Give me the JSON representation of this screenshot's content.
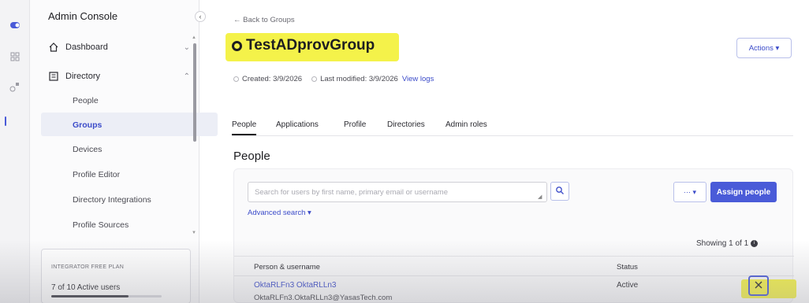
{
  "sidebar": {
    "app_title": "Admin Console",
    "collapse_glyph": "‹",
    "nav": [
      {
        "label": "Dashboard",
        "icon": "home-icon",
        "chevron": "⌄"
      },
      {
        "label": "Directory",
        "icon": "directory-icon",
        "chevron": "⌃"
      }
    ],
    "directory_items": [
      "People",
      "Groups",
      "Devices",
      "Profile Editor",
      "Directory Integrations",
      "Profile Sources"
    ],
    "selected_item": "Groups",
    "plan": {
      "label": "INTEGRATOR FREE PLAN",
      "users_text": "7 of 10 Active users",
      "usage_fraction": 0.7
    }
  },
  "main": {
    "back_link": "← Back to Groups",
    "group_name": "TestADprovGroup",
    "actions_label": "Actions ▾",
    "created": "Created: 3/9/2026",
    "modified": "Last modified: 3/9/2026",
    "view_logs": "View logs",
    "tabs": [
      "People",
      "Applications",
      "Profile",
      "Directories",
      "Admin roles"
    ],
    "active_tab": "People",
    "section_title": "People",
    "search_placeholder": "Search for users by first name, primary email or username",
    "advanced_search": "Advanced search ▾",
    "more_label": "··· ▾",
    "assign_label": "Assign people",
    "showing": "Showing 1 of 1",
    "columns": [
      "Person & username",
      "Status"
    ],
    "rows": [
      {
        "name": "OktaRLFn3 OktaRLLn3",
        "email": "OktaRLFn3.OktaRLLn3@YasasTech.com",
        "status": "Active"
      }
    ]
  },
  "colors": {
    "accent": "#4a5bd8",
    "highlight": "#f4f24a",
    "text": "#1d1d21"
  }
}
